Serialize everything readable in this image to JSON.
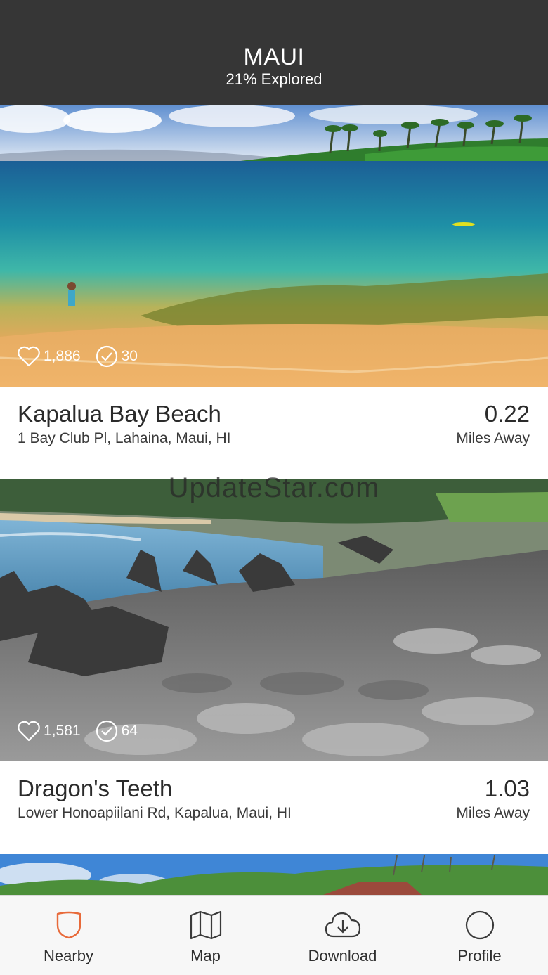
{
  "header": {
    "title": "MAUI",
    "subtitle": "21% Explored"
  },
  "places": [
    {
      "name": "Kapalua Bay Beach",
      "address": "1 Bay Club Pl, Lahaina, Maui, HI",
      "distance": "0.22",
      "distance_unit": "Miles Away",
      "likes": "1,886",
      "visits": "30"
    },
    {
      "name": "Dragon's Teeth",
      "address": "Lower Honoapiilani Rd, Kapalua, Maui, HI",
      "distance": "1.03",
      "distance_unit": "Miles Away",
      "likes": "1,581",
      "visits": "64"
    }
  ],
  "watermark": "UpdateStar.com",
  "tabs": [
    {
      "label": "Nearby",
      "icon": "shield-icon",
      "active": true
    },
    {
      "label": "Map",
      "icon": "map-icon",
      "active": false
    },
    {
      "label": "Download",
      "icon": "cloud-download-icon",
      "active": false
    },
    {
      "label": "Profile",
      "icon": "circle-icon",
      "active": false
    }
  ],
  "colors": {
    "header_bg": "#363636",
    "accent": "#e86a3a",
    "tabbar_bg": "#f7f7f7"
  }
}
